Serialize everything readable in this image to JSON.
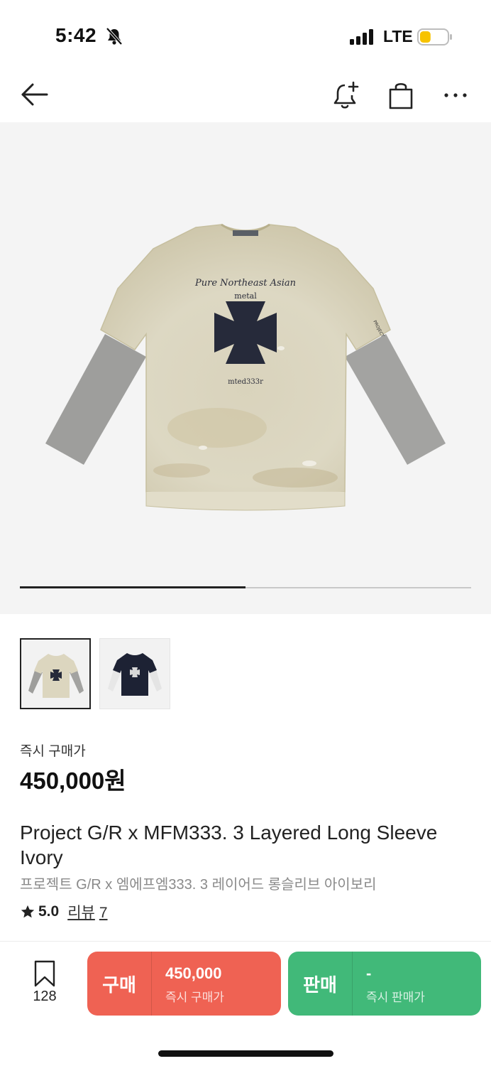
{
  "status_bar": {
    "time": "5:42",
    "network": "LTE",
    "battery_level": 0.4,
    "battery_color": "#f7c300"
  },
  "nav": {
    "icons": [
      "back-arrow-icon",
      "bell-plus-icon",
      "shopping-bag-icon",
      "more-horizontal-icon"
    ]
  },
  "gallery": {
    "progress": 0.5,
    "progress_color": "#222222",
    "thumbnails": [
      {
        "label": "ivory-shirt",
        "selected": true
      },
      {
        "label": "navy-shirt",
        "selected": false
      }
    ]
  },
  "product": {
    "price_label": "즉시 구매가",
    "price": "450,000원",
    "title_en": "Project G/R x MFM333. 3 Layered Long Sleeve Ivory",
    "title_ko": "프로젝트 G/R x 엠에프엠333. 3 레이어드 롱슬리브 아이보리",
    "print_line1": "Pure Northeast Asian",
    "print_line2": "metal",
    "print_line3": "mted333r",
    "sleeve_print": "PROJECT",
    "rating": "5.0",
    "review_label": "리뷰",
    "review_count": "7"
  },
  "action_bar": {
    "wish_count": "128",
    "buy": {
      "kind": "구매",
      "price": "450,000",
      "sub": "즉시 구매가",
      "color": "#ef6253"
    },
    "sell": {
      "kind": "판매",
      "price": "-",
      "sub": "즉시 판매가",
      "color": "#41b979"
    }
  }
}
